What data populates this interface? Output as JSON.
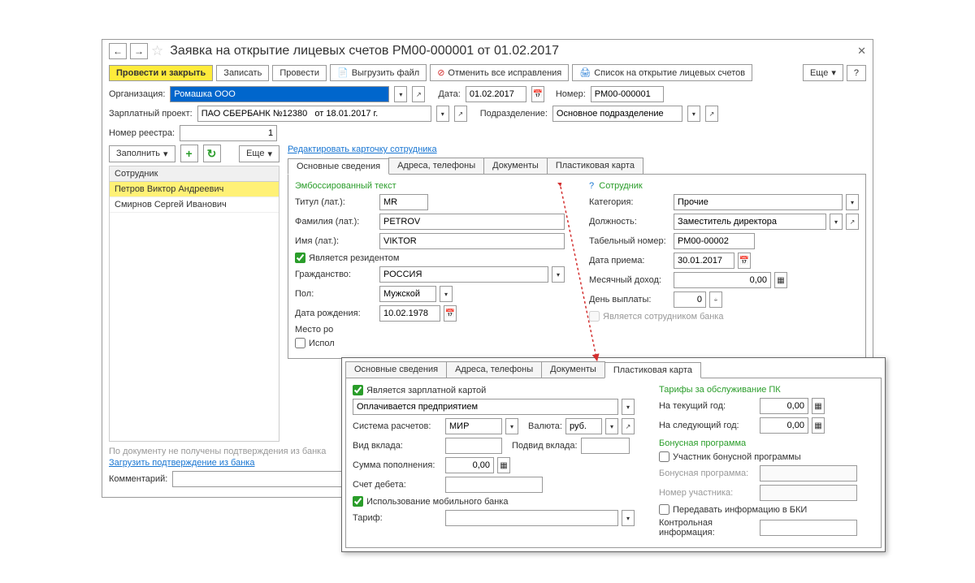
{
  "title": "Заявка на открытие лицевых счетов РМ00-000001 от 01.02.2017",
  "toolbar": {
    "post_close": "Провести и закрыть",
    "write": "Записать",
    "post": "Провести",
    "export": "Выгрузить файл",
    "cancel_fix": "Отменить все исправления",
    "open_list": "Список на открытие лицевых счетов",
    "more": "Еще"
  },
  "fields": {
    "org_label": "Организация:",
    "org_value": "Ромашка ООО",
    "date_label": "Дата:",
    "date_value": "01.02.2017",
    "number_label": "Номер:",
    "number_value": "РМ00-000001",
    "project_label": "Зарплатный проект:",
    "project_value": "ПАО СБЕРБАНК №12380   от 18.01.2017 г.",
    "dept_label": "Подразделение:",
    "dept_value": "Основное подразделение",
    "reg_label": "Номер реестра:",
    "reg_value": "1"
  },
  "left": {
    "fill": "Заполнить",
    "more": "Еще",
    "header": "Сотрудник",
    "emp1": "Петров Виктор Андреевич",
    "emp2": "Смирнов Сергей Иванович",
    "no_confirm": "По документу не получены подтверждения из банка",
    "load_confirm": "Загрузить подтверждение из банка",
    "comment": "Комментарий:"
  },
  "edit_link": "Редактировать карточку сотрудника",
  "tabs": {
    "t1": "Основные сведения",
    "t2": "Адреса, телефоны",
    "t3": "Документы",
    "t4": "Пластиковая карта"
  },
  "emboss": {
    "title": "Эмбоссированный текст",
    "titul_label": "Титул (лат.):",
    "titul_value": "MR",
    "fam_label": "Фамилия (лат.):",
    "fam_value": "PETROV",
    "name_label": "Имя (лат.):",
    "name_value": "VIKTOR",
    "resident": "Является резидентом",
    "citizen_label": "Гражданство:",
    "citizen_value": "РОССИЯ",
    "gender_label": "Пол:",
    "gender_value": "Мужской",
    "dob_label": "Дата рождения:",
    "dob_value": "10.02.1978",
    "place_label": "Место ро",
    "ispol": "Испол"
  },
  "emp": {
    "title": "Сотрудник",
    "cat_label": "Категория:",
    "cat_value": "Прочие",
    "pos_label": "Должность:",
    "pos_value": "Заместитель директора",
    "tab_label": "Табельный номер:",
    "tab_value": "РМ00-00002",
    "hire_label": "Дата приема:",
    "hire_value": "30.01.2017",
    "income_label": "Месячный доход:",
    "income_value": "0,00",
    "payday_label": "День выплаты:",
    "payday_value": "0",
    "bank_emp": "Является сотрудником банка"
  },
  "card": {
    "salary_card": "Является зарплатной картой",
    "paid_by": "Оплачивается предприятием",
    "system_label": "Система расчетов:",
    "system_value": "МИР",
    "currency_label": "Валюта:",
    "currency_value": "руб.",
    "deposit_label": "Вид вклада:",
    "subdeposit_label": "Подвид вклада:",
    "topup_label": "Сумма пополнения:",
    "topup_value": "0,00",
    "debit_label": "Счет дебета:",
    "mobile_bank": "Использование мобильного банка",
    "tariff_label": "Тариф:",
    "tariffs_title": "Тарифы за обслуживание ПК",
    "curr_year_label": "На текущий год:",
    "curr_year_value": "0,00",
    "next_year_label": "На следующий год:",
    "next_year_value": "0,00",
    "bonus_title": "Бонусная программа",
    "bonus_member": "Участник бонусной программы",
    "bonus_prog_label": "Бонусная программа:",
    "member_no_label": "Номер участника:",
    "bki": "Передавать информацию в БКИ",
    "ctrl_info_label": "Контрольная информация:"
  }
}
